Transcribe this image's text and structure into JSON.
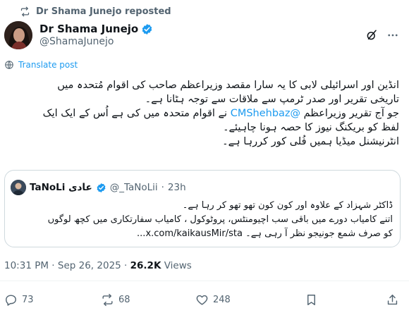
{
  "repost": {
    "label": "Dr Shama Junejo reposted"
  },
  "author": {
    "name": "Dr Shama Junejo",
    "handle": "@ShamaJunejo"
  },
  "translate": {
    "label": "Translate post"
  },
  "tweet": {
    "line1": "انڈین اور اسرائیلی لابی کا یہ سارا مقصد وزیراعظم صاحب کی اقوام مُتحدہ میں",
    "line2": "تاریخی تقریر اور صدر ٹرمپ سے ملاقات سے توجہ ہٹانا ہے۔",
    "line3_pre": "جو آج تقریر وزیراعظم ",
    "mention": "@CMShehbaz",
    "line3_post": " نے اقوام متحدہ میں کی ہے اُس کے ایک ایک",
    "line4": "لفظ کو بریکنگ نیوز کا حصہ ہونا چاہیئے۔",
    "line5": "انٹرنیشنل میڈیا ہمیں فُلی کور کررہا ہے۔"
  },
  "quote": {
    "name": "TaNoLi عادی",
    "handle": "@_TaNoLii",
    "dot": "·",
    "time": "23h",
    "line1": "ڈاکٹر شہزاد کے علاوہ اور کون کون تھو تھو کر رہا ہے۔",
    "line2": "اتنے کامیاب دورے میں باقی سب اچیومنٹس، پروٹوکول ، کامیاب سفارتکاری میں کچھ لوگوں",
    "line3": "کو صرف شمع جونیجو نظر آ رہی ہے۔ x.com/kaikausMir/sta..."
  },
  "meta": {
    "time": "10:31 PM",
    "sep1": "·",
    "date": "Sep 26, 2025",
    "sep2": "·",
    "views_count": "26.2K",
    "views_label": "Views"
  },
  "stats": {
    "replies": "73",
    "reposts": "68",
    "likes": "248"
  },
  "colors": {
    "accent": "#1d9bf0",
    "muted": "#536471",
    "text": "#0f1419",
    "border": "#cfd9de"
  }
}
